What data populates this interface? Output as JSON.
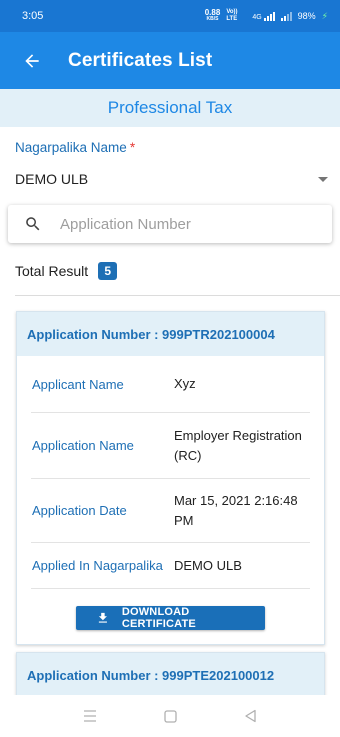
{
  "status_bar": {
    "time": "3:05",
    "speed": "0.88",
    "speed_unit": "KB/S",
    "volte": "Vo)) LTE",
    "network": "4G",
    "battery": "98%"
  },
  "app_bar": {
    "title": "Certificates List",
    "back_icon": "arrow-left-icon"
  },
  "section": {
    "title": "Professional Tax"
  },
  "filter": {
    "label": "Nagarpalika Name",
    "required_mark": "*",
    "selected": "DEMO ULB"
  },
  "search": {
    "placeholder": "Application Number",
    "value": ""
  },
  "total": {
    "label": "Total Result",
    "count": "5"
  },
  "cards": [
    {
      "header": "Application Number : 999PTR202100004",
      "rows": [
        {
          "label": "Applicant Name",
          "value": "Xyz"
        },
        {
          "label": "Application Name",
          "value": "Employer Registration (RC)"
        },
        {
          "label": "Application Date",
          "value": "Mar 15, 2021 2:16:48 PM"
        },
        {
          "label": "Applied In Nagarpalika",
          "value": "DEMO ULB"
        }
      ],
      "download_label": "DOWNLOAD CERTIFICATE"
    },
    {
      "header": "Application Number : 999PTE202100012"
    }
  ],
  "colors": {
    "primary": "#1e88e5",
    "primary_dark": "#1976d2",
    "accent_text": "#1e6fb5",
    "banner_bg": "#e2f0f8"
  }
}
